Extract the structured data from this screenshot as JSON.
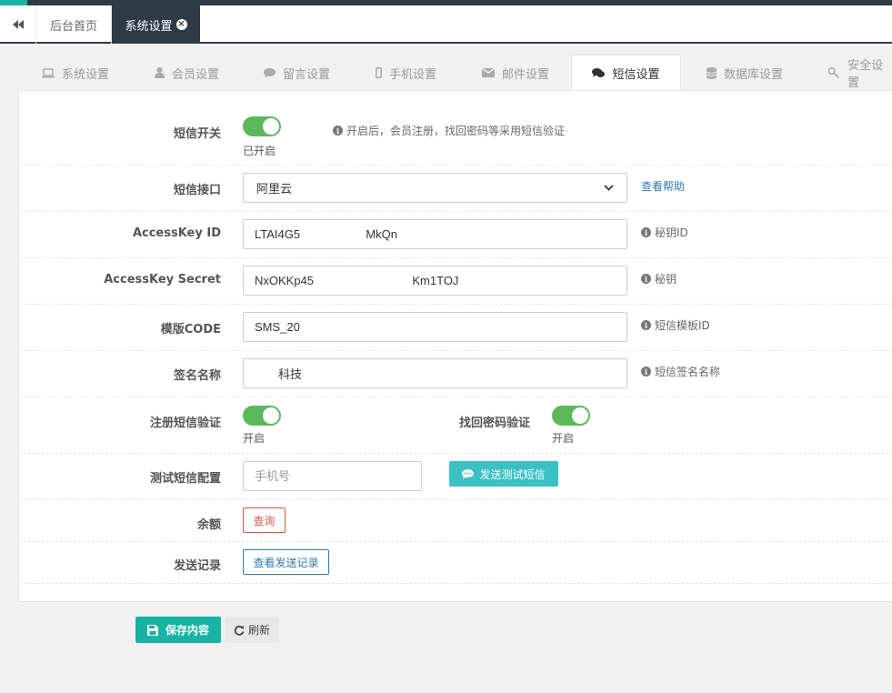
{
  "tabs": {
    "home": "后台首页",
    "active": "系统设置"
  },
  "settings_tabs": [
    {
      "label": "系统设置",
      "icon": "laptop-icon"
    },
    {
      "label": "会员设置",
      "icon": "user-icon"
    },
    {
      "label": "留言设置",
      "icon": "comment-icon"
    },
    {
      "label": "手机设置",
      "icon": "mobile-icon"
    },
    {
      "label": "邮件设置",
      "icon": "envelope-icon"
    },
    {
      "label": "短信设置",
      "icon": "comments-icon"
    },
    {
      "label": "数据库设置",
      "icon": "database-icon"
    },
    {
      "label": "安全设置",
      "icon": "key-icon"
    }
  ],
  "form": {
    "sms_switch": {
      "label": "短信开关",
      "state": "已开启",
      "hint": "开启后，会员注册，找回密码等采用短信验证"
    },
    "sms_api": {
      "label": "短信接口",
      "value": "阿里云",
      "help": "查看帮助"
    },
    "access_key_id": {
      "label": "AccessKey ID",
      "value": "LTAI4G5                    MkQn",
      "hint": "秘钥ID"
    },
    "access_key_secret": {
      "label": "AccessKey Secret",
      "value": "NxOKKp45                              Km1TOJ",
      "hint": "秘钥"
    },
    "template_code": {
      "label": "模版CODE",
      "value": "SMS_20",
      "hint": "短信模板ID"
    },
    "sign_name": {
      "label": "签名名称",
      "value": "科技",
      "hint": "短信签名名称"
    },
    "register_verify": {
      "label": "注册短信验证",
      "state": "开启"
    },
    "recover_verify": {
      "label": "找回密码验证",
      "state": "开启"
    },
    "test_sms": {
      "label": "测试短信配置",
      "placeholder": "手机号",
      "button": "发送测试短信"
    },
    "balance": {
      "label": "余额",
      "button": "查询"
    },
    "send_records": {
      "label": "发送记录",
      "button": "查看发送记录"
    }
  },
  "actions": {
    "save": "保存内容",
    "refresh": "刷新"
  },
  "colors": {
    "accent": "#17b3a3",
    "dark": "#2f3a47",
    "switch_on": "#5cb85c",
    "link": "#2c78b4",
    "danger": "#d9534f",
    "send_button": "#3bc0c3"
  }
}
